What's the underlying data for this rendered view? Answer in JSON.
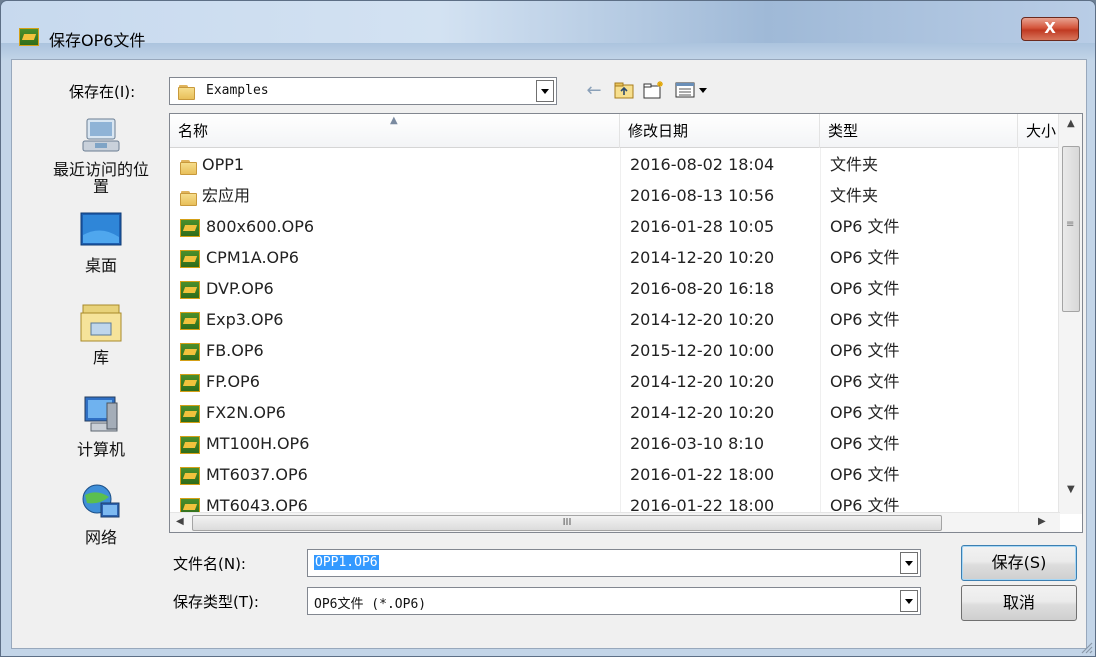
{
  "window": {
    "title": "保存OP6文件",
    "close_label": "X"
  },
  "location": {
    "label": "保存在(I):",
    "value": "Examples"
  },
  "toolbar": {
    "back_icon": "back-arrow-icon",
    "up_icon": "up-folder-icon",
    "new_folder_icon": "new-folder-icon",
    "view_icon": "view-menu-icon"
  },
  "sidebar": {
    "items": [
      {
        "label": "最近访问的位置",
        "icon": "recent-places-icon"
      },
      {
        "label": "桌面",
        "icon": "desktop-icon"
      },
      {
        "label": "库",
        "icon": "libraries-icon"
      },
      {
        "label": "计算机",
        "icon": "computer-icon"
      },
      {
        "label": "网络",
        "icon": "network-icon"
      }
    ]
  },
  "columns": {
    "name": "名称",
    "date": "修改日期",
    "type": "类型",
    "size": "大小"
  },
  "files": [
    {
      "name": "OPP1",
      "date": "2016-08-02 18:04",
      "type": "文件夹",
      "kind": "folder"
    },
    {
      "name": "宏应用",
      "date": "2016-08-13 10:56",
      "type": "文件夹",
      "kind": "folder"
    },
    {
      "name": "800x600.OP6",
      "date": "2016-01-28 10:05",
      "type": "OP6 文件",
      "kind": "op6"
    },
    {
      "name": "CPM1A.OP6",
      "date": "2014-12-20 10:20",
      "type": "OP6 文件",
      "kind": "op6"
    },
    {
      "name": "DVP.OP6",
      "date": "2016-08-20 16:18",
      "type": "OP6 文件",
      "kind": "op6"
    },
    {
      "name": "Exp3.OP6",
      "date": "2014-12-20 10:20",
      "type": "OP6 文件",
      "kind": "op6"
    },
    {
      "name": "FB.OP6",
      "date": "2015-12-20 10:00",
      "type": "OP6 文件",
      "kind": "op6"
    },
    {
      "name": "FP.OP6",
      "date": "2014-12-20 10:20",
      "type": "OP6 文件",
      "kind": "op6"
    },
    {
      "name": "FX2N.OP6",
      "date": "2014-12-20 10:20",
      "type": "OP6 文件",
      "kind": "op6"
    },
    {
      "name": "MT100H.OP6",
      "date": "2016-03-10 8:10",
      "type": "OP6 文件",
      "kind": "op6"
    },
    {
      "name": "MT6037.OP6",
      "date": "2016-01-22 18:00",
      "type": "OP6 文件",
      "kind": "op6"
    },
    {
      "name": "MT6043.OP6",
      "date": "2016-01-22 18:00",
      "type": "OP6 文件",
      "kind": "op6"
    }
  ],
  "hscroll_grip": "III",
  "filename": {
    "label": "文件名(N):",
    "value": "OPP1.OP6"
  },
  "filetype": {
    "label": "保存类型(T):",
    "value": "OP6文件 (*.OP6)"
  },
  "buttons": {
    "save": "保存(S)",
    "cancel": "取消"
  }
}
